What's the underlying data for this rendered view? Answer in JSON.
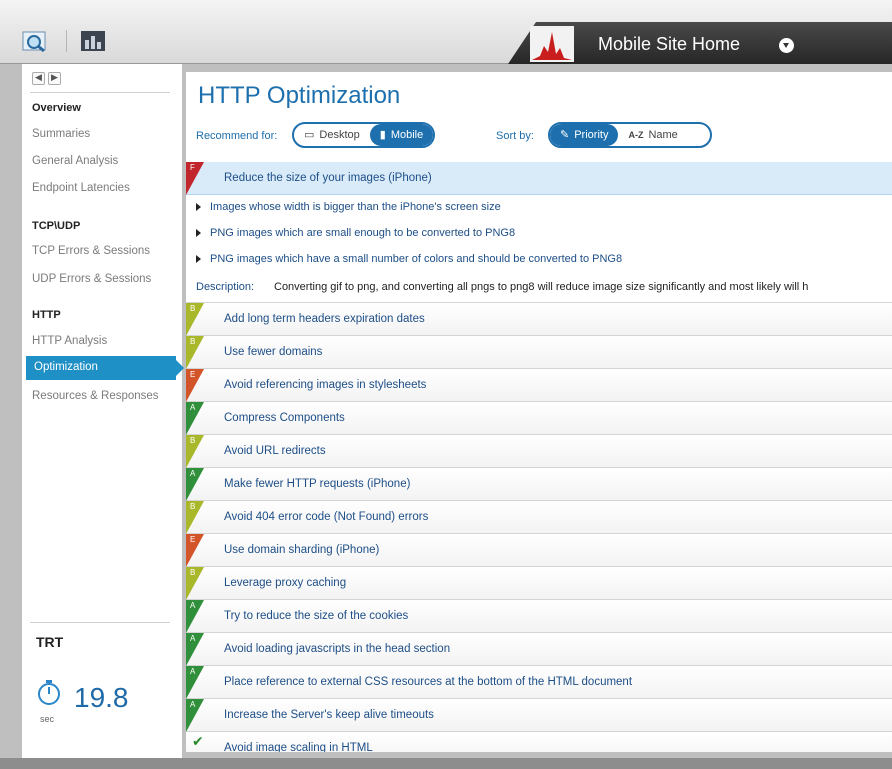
{
  "site_tab": {
    "title": "Mobile Site Home"
  },
  "sidebar": {
    "sections": [
      {
        "header": "Overview",
        "items": [
          "Summaries",
          "General Analysis",
          "Endpoint Latencies"
        ]
      },
      {
        "header": "TCP\\UDP",
        "items": [
          "TCP Errors & Sessions",
          "UDP Errors & Sessions"
        ]
      },
      {
        "header": "HTTP",
        "items": [
          "HTTP Analysis",
          "Optimization",
          "Resources & Responses"
        ]
      }
    ],
    "active_item": "Optimization",
    "trt": {
      "label": "TRT",
      "value": "19.8",
      "unit": "sec"
    }
  },
  "main": {
    "title": "HTTP Optimization",
    "recommend_label": "Recommend for:",
    "recommend_options": [
      "Desktop",
      "Mobile"
    ],
    "recommend_selected": "Mobile",
    "sort_label": "Sort by:",
    "sort_options": [
      "Priority",
      "Name"
    ],
    "sort_selected": "Priority",
    "sort_name_prefix": "A-Z",
    "expanded_rule": {
      "grade": "F",
      "title": "Reduce the size of your images (iPhone)",
      "details": [
        "Images whose width is bigger than the iPhone's screen size",
        "PNG images which are small enough to be converted to PNG8",
        "PNG images which have a small number of colors and should be converted to PNG8"
      ],
      "description_label": "Description:",
      "description": "Converting gif to png, and converting all pngs to png8 will reduce image size significantly and most likely will h"
    },
    "rules": [
      {
        "grade": "B",
        "title": "Add long term headers expiration dates"
      },
      {
        "grade": "B",
        "title": "Use fewer domains"
      },
      {
        "grade": "E",
        "title": "Avoid referencing images in stylesheets"
      },
      {
        "grade": "A",
        "title": "Compress Components"
      },
      {
        "grade": "B",
        "title": "Avoid URL redirects"
      },
      {
        "grade": "A",
        "title": "Make fewer HTTP requests (iPhone)"
      },
      {
        "grade": "B",
        "title": "Avoid 404 error code (Not Found) errors"
      },
      {
        "grade": "E",
        "title": "Use domain sharding (iPhone)"
      },
      {
        "grade": "B",
        "title": "Leverage proxy caching"
      },
      {
        "grade": "A",
        "title": "Try to reduce the size of the cookies"
      },
      {
        "grade": "A",
        "title": "Avoid loading javascripts in the head section"
      },
      {
        "grade": "A",
        "title": "Place reference to external CSS resources at the bottom of the HTML document"
      },
      {
        "grade": "A",
        "title": "Increase the Server's keep alive timeouts"
      },
      {
        "grade": "check",
        "title": "Avoid image scaling in HTML"
      }
    ],
    "grade_colors": {
      "A": "#2f8f3a",
      "B": "#a9b82a",
      "E": "#d4542a",
      "F": "#c0262c"
    }
  },
  "icons": {
    "toolbar": [
      "magnify-chart-icon",
      "bar-chart-icon"
    ],
    "site_tab": "red-waveform-chart-icon",
    "dropdown": "chevron-down-circle-icon",
    "trt": "stopwatch-icon"
  }
}
